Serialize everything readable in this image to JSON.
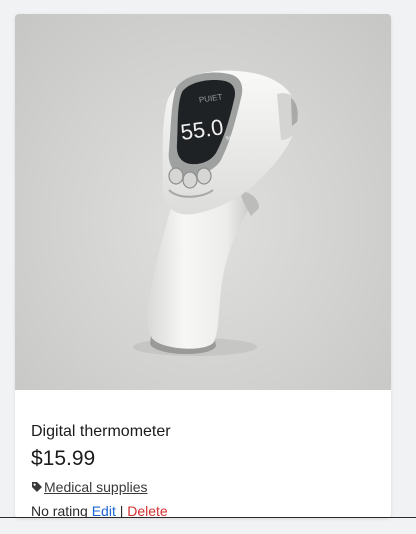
{
  "product": {
    "title": "Digital thermometer",
    "price": "$15.99",
    "category": "Medical supplies",
    "rating_text": "No rating",
    "edit_label": "Edit",
    "separator": "|",
    "delete_label": "Delete",
    "image": {
      "brand_text": "PUIET",
      "display_reading": "55.0",
      "display_unit": "%"
    }
  },
  "icons": {
    "category": "tag-icon"
  },
  "colors": {
    "edit_link": "#1a66d2",
    "delete_link": "#d32f2f",
    "page_background": "#f1f2f4",
    "card_background": "#ffffff"
  }
}
